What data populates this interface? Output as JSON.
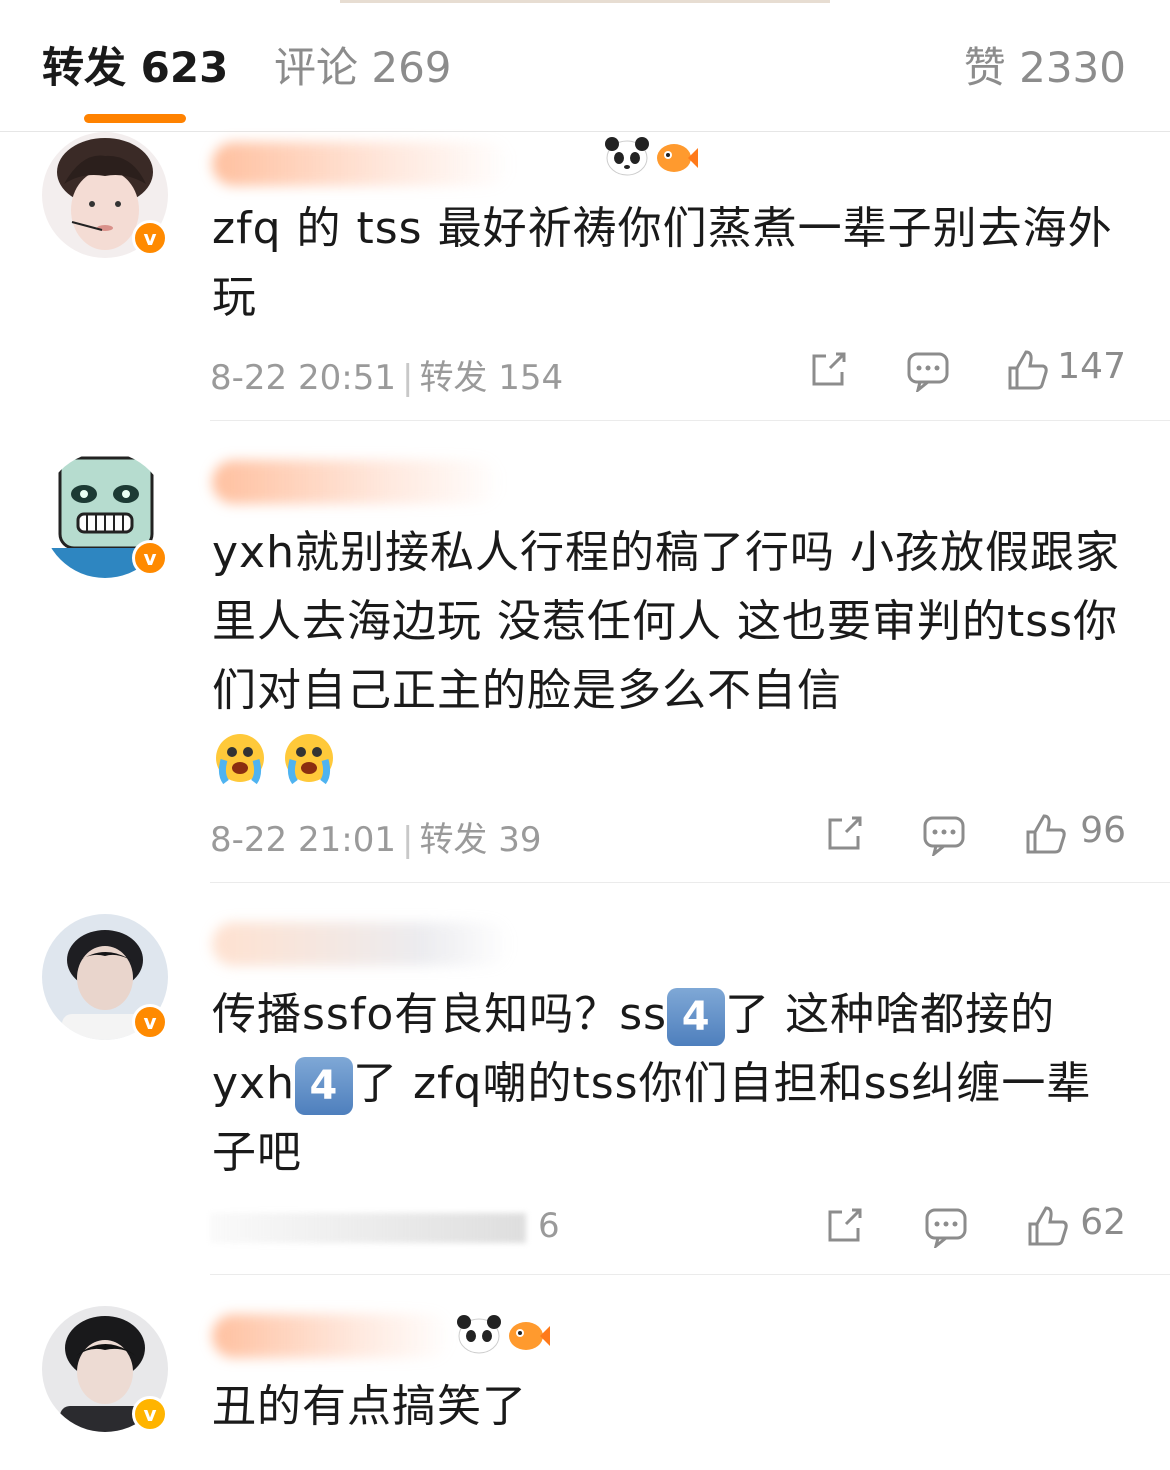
{
  "tabs": {
    "repost": "转发 623",
    "comment": "评论 269",
    "like": "赞 2330"
  },
  "colors": {
    "accent": "#ff8200",
    "vip_badge": "#ff8a00",
    "muted": "#9a9a9a"
  },
  "comments": [
    {
      "text": "zfq 的 tss 最好祈祷你们蒸煮一辈子别去海外玩",
      "time": "8-22 20:51",
      "repost": "转发 154",
      "likes": "147",
      "emoji": []
    },
    {
      "text": "yxh就别接私人行程的稿了行吗 小孩放假跟家里人去海边玩 没惹任何人 这也要审判的tss你们对自己正主的脸是多么不自信",
      "time": "8-22 21:01",
      "repost": "转发 39",
      "likes": "96",
      "emoji": [
        "crying-face-icon",
        "crying-face-icon"
      ]
    },
    {
      "text_parts": [
        "传播ssfo有良知吗？ss",
        "4",
        "了 这种啥都接的 yxh",
        "4",
        "了 zfq嘲的tss你们自担和ss纠缠一辈子吧"
      ],
      "meta_tail": "6",
      "likes": "62"
    },
    {
      "text": "丑的有点搞笑了"
    }
  ],
  "icons": [
    "share-icon",
    "comment-icon",
    "like-icon",
    "verified-badge-icon"
  ]
}
